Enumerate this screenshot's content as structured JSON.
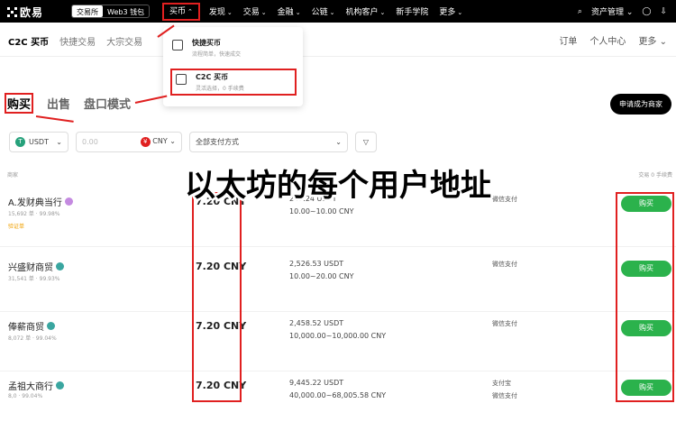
{
  "topbar": {
    "logo": "欧易",
    "exchange": "交易所",
    "web3": "Web3 钱包",
    "nav": [
      "买币",
      "发现",
      "交易",
      "金融",
      "公链",
      "机构客户",
      "新手学院",
      "更多"
    ],
    "asset": "资产管理"
  },
  "subnav": {
    "left": [
      "C2C 买币",
      "快捷交易",
      "大宗交易"
    ],
    "right": [
      "订单",
      "个人中心",
      "更多"
    ]
  },
  "dropdown": [
    {
      "title": "快捷买币",
      "desc": "流程简单，快速成交"
    },
    {
      "title": "C2C 买币",
      "desc": "灵活选择，0 手续费"
    }
  ],
  "tabs": [
    "购买",
    "出售",
    "盘口模式"
  ],
  "apply_button": "申请成为商家",
  "filters": {
    "coin": "USDT",
    "amount_placeholder": "0.00",
    "fiat": "CNY",
    "payment": "全部支付方式"
  },
  "banner": "以太坊的每个用户地址",
  "header": {
    "merchant": "商家",
    "fee": "交易 0 手续费"
  },
  "rows": [
    {
      "name": "A.发财典当行",
      "stats": "15,692 单 · 99.98%",
      "verified": "验证单",
      "price": "7.20 CNY",
      "qty": "247.24 USDT",
      "limit": "10.00~10.00 CNY",
      "pay": "微信支付",
      "pay2": "",
      "buy": "购买"
    },
    {
      "name": "兴盛财商贸",
      "stats": "31,541 单 · 99.93%",
      "verified": "",
      "price": "7.20 CNY",
      "qty": "2,526.53 USDT",
      "limit": "10.00~20.00 CNY",
      "pay": "微信支付",
      "pay2": "",
      "buy": "购买"
    },
    {
      "name": "俸薪商贸",
      "stats": "8,072 单 · 99.04%",
      "verified": "",
      "price": "7.20 CNY",
      "qty": "2,458.52 USDT",
      "limit": "10,000.00~10,000.00 CNY",
      "pay": "微信支付",
      "pay2": "",
      "buy": "购买"
    },
    {
      "name": "孟祖大商行",
      "stats": "8,0 · 99.04%",
      "verified": "",
      "price": "7.20 CNY",
      "qty": "9,445.22 USDT",
      "limit": "40,000.00~68,005.58 CNY",
      "pay": "支付宝",
      "pay2": "微信支付",
      "buy": "购买"
    }
  ],
  "colors": {
    "accent": "#e02020",
    "buy": "#2bb24c",
    "badge": "#3aa6a0"
  }
}
